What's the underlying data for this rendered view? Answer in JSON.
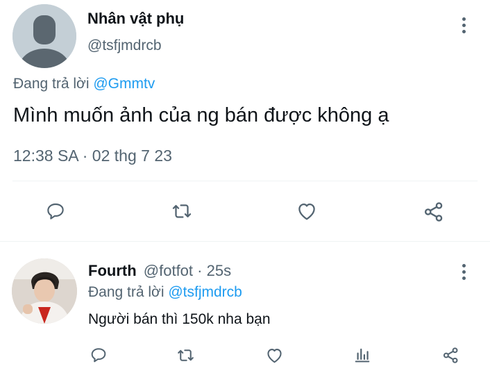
{
  "main_tweet": {
    "display_name": "Nhân vật phụ",
    "handle": "@tsfjmdrcb",
    "replying_prefix": "Đang trả lời",
    "replying_to": "@Gmmtv",
    "text": "Mình muốn ảnh của ng bán được không ạ",
    "timestamp": "12:38 SA · 02 thg 7 23",
    "actions": [
      "reply-icon",
      "retweet-icon",
      "like-icon",
      "share-icon"
    ]
  },
  "reply_tweet": {
    "display_name": "Fourth",
    "handle": "@fotfot",
    "time_ago": "· 25s",
    "replying_prefix": "Đang trả lời",
    "replying_to": "@tsfjmdrcb",
    "text": "Người bán thì 150k nha bạn",
    "actions": [
      "reply-icon",
      "retweet-icon",
      "like-icon",
      "analytics-icon",
      "share-icon"
    ]
  },
  "colors": {
    "link": "#1d9bf0",
    "muted": "#536471",
    "icon": "#536471",
    "divider": "#eff3f4",
    "placeholder_avatar": "#c4cfd6"
  }
}
